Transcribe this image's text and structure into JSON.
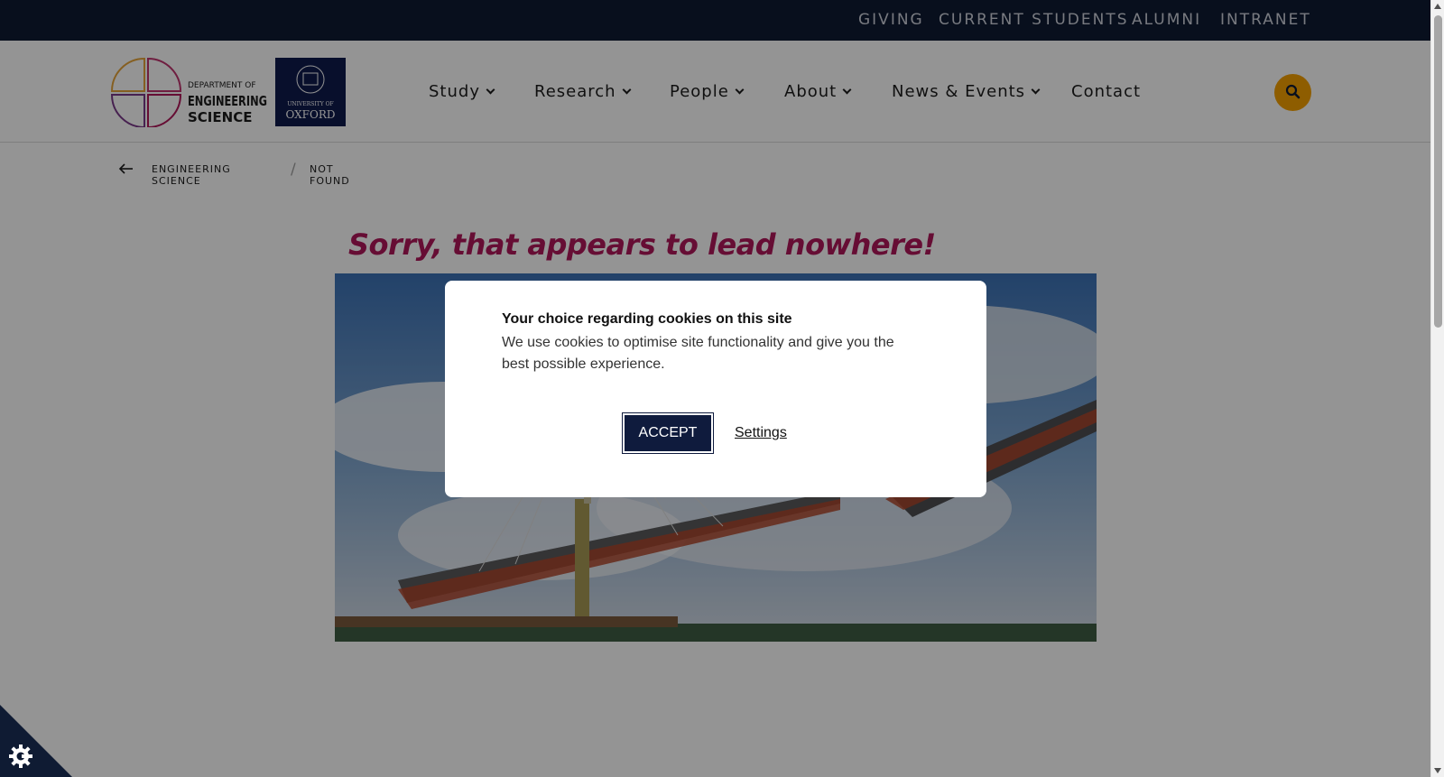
{
  "topbar": {
    "links": [
      "GIVING",
      "CURRENT STUDENTS",
      "ALUMNI",
      "INTRANET"
    ]
  },
  "logo": {
    "department_lines": [
      "DEPARTMENT OF",
      "ENGINEERING",
      "SCIENCE"
    ],
    "oxford_lines": [
      "UNIVERSITY OF",
      "OXFORD"
    ]
  },
  "nav": {
    "items": [
      "Study",
      "Research",
      "People",
      "About",
      "News & Events",
      "Contact"
    ]
  },
  "breadcrumb": {
    "items": [
      "ENGINEERING SCIENCE",
      "NOT FOUND"
    ],
    "separator": "/"
  },
  "main": {
    "heading": "Sorry, that appears to lead nowhere!"
  },
  "cookie_modal": {
    "title": "Your choice regarding cookies on this site",
    "text": "We use cookies to optimise site functionality and give you the best possible experience.",
    "accept_label": "ACCEPT",
    "settings_label": "Settings"
  },
  "icons": {
    "search": "search-icon",
    "back": "arrow-left-icon",
    "cookie": "cookie-settings-icon"
  },
  "colors": {
    "topbar": "#0f1b33",
    "heading": "#b0185a",
    "search_button": "#f5a000",
    "accept_button": "#0f1b3d",
    "oxford_blue": "#0f1b4d"
  }
}
